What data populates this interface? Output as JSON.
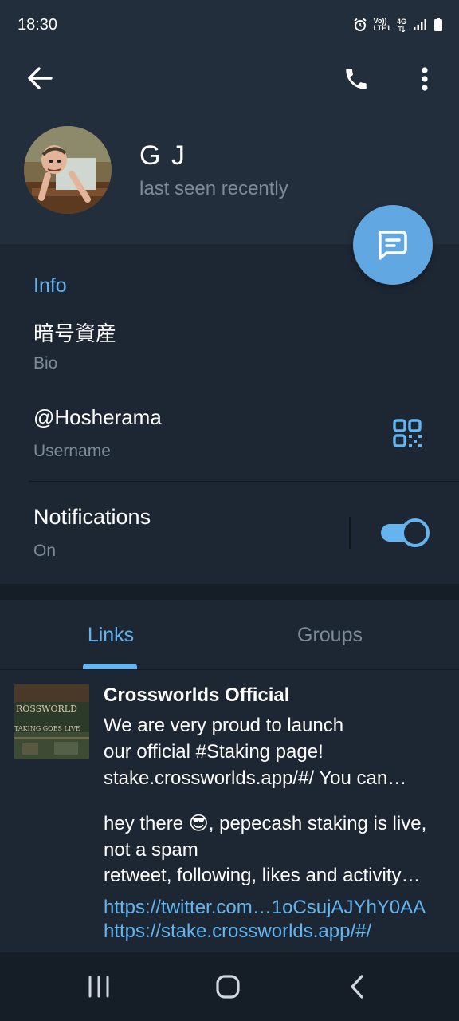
{
  "status_bar": {
    "time": "18:30",
    "volte": "Vo))",
    "lte": "LTE1",
    "network": "4G"
  },
  "header": {
    "back_icon": "arrow-left-icon",
    "call_icon": "phone-icon",
    "more_icon": "more-vertical-icon"
  },
  "profile": {
    "name": "G J",
    "status": "last seen recently"
  },
  "info": {
    "title": "Info",
    "bio_value": "暗号資産",
    "bio_label": "Bio",
    "username_value": "@Hosherama",
    "username_label": "Username",
    "notifications_value": "Notifications",
    "notifications_label": "On",
    "notifications_on": true
  },
  "tabs": [
    {
      "label": "Links",
      "active": true
    },
    {
      "label": "Groups",
      "active": false
    }
  ],
  "links": {
    "thumb_text_1": "ROSSWORLD",
    "thumb_text_2": "TAKING GOES LIVE",
    "title": "Crossworlds Official",
    "line1": "We are very proud to launch",
    "line2": "our official #Staking page!",
    "line3": "stake.crossworlds.app/#/ You can…",
    "line4": "hey there 😎, pepecash staking is live,",
    "line5": "not a spam",
    "line6": "retweet, following, likes and activity…",
    "url1": "https://twitter.com…1oCsujAJYhY0AA",
    "url2": "https://stake.crossworlds.app/#/"
  },
  "colors": {
    "accent": "#64b5ef",
    "header_bg": "#232e3c",
    "body_bg": "#1d2733",
    "fab": "#61a8e2"
  }
}
